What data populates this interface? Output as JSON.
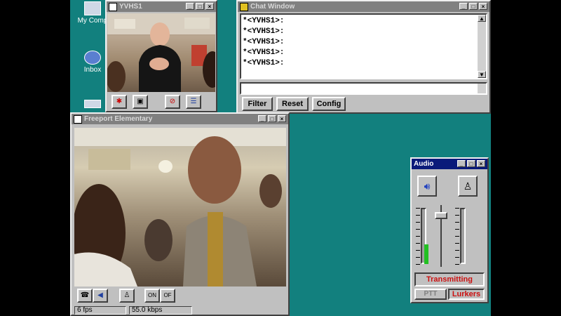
{
  "desktop": {
    "icons": [
      {
        "label": "My Comp",
        "icon": "computer-icon"
      },
      {
        "label": "Inbox",
        "icon": "inbox-icon"
      }
    ]
  },
  "video_top": {
    "title": "YVHS1",
    "toolbar_icons": [
      "snapshot-icon",
      "window-icon",
      "stop-icon",
      "settings-icon"
    ]
  },
  "chat": {
    "title": "Chat Window",
    "lines": [
      "*<YVHS1>:",
      "*<YVHS1>:",
      "*<YVHS1>:",
      "*<YVHS1>:",
      "*<YVHS1>:"
    ],
    "buttons": {
      "filter": "Filter",
      "reset": "Reset",
      "config": "Config"
    }
  },
  "video_main": {
    "title": "Freeport Elementary",
    "status": {
      "fps": "6 fps",
      "bandwidth": "55.0 kbps"
    }
  },
  "audio": {
    "title": "Audio",
    "transmitting": "Transmitting",
    "ptt": "PTT",
    "lurkers": "Lurkers",
    "mic_level": 0.35
  },
  "colors": {
    "desktop": "#12807e",
    "title_active": "#0a1a7a",
    "transmit_red": "#cc1010",
    "meter_green": "#22c022"
  }
}
